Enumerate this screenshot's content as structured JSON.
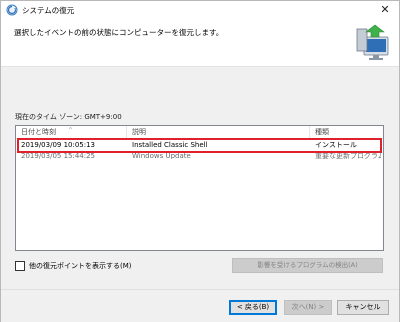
{
  "window": {
    "title": "システムの復元",
    "close_glyph": "✕"
  },
  "header": {
    "instruction": "選択したイベントの前の状態にコンピューターを復元します。"
  },
  "timezone_label": "現在のタイム ゾーン: GMT+9:00",
  "list": {
    "columns": [
      "日付と時刻",
      "説明",
      "種類"
    ],
    "rows": [
      {
        "datetime": "2019/03/09 10:05:13",
        "description": "Installed Classic Shell",
        "type": "インストール"
      },
      {
        "datetime": "2019/03/05 15:44:25",
        "description": "Windows Update",
        "type": "重要な更新プログラム"
      }
    ]
  },
  "show_more_label": "他の復元ポイントを表示する(M)",
  "scan_button_label": "影響を受けるプログラムの検出(A)",
  "footer": {
    "back_label": "< 戻る(B)",
    "next_label": "次へ(N) >",
    "cancel_label": "キャンセル"
  },
  "colors": {
    "highlight_border": "#e0202d",
    "focus_border": "#0078d7"
  },
  "icons": {
    "title_icon": "system-restore-icon",
    "header_icon": "restore-computer-icon"
  }
}
